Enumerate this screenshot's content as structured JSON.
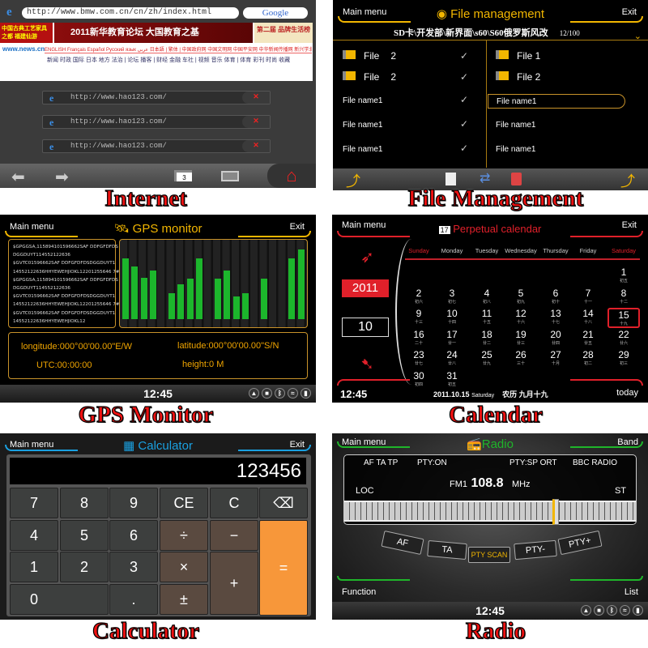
{
  "captions": {
    "internet": "Internet",
    "file": "File Management",
    "gps": "GPS Monitor",
    "calendar": "Calendar",
    "calculator": "Calculator",
    "radio": "Radio"
  },
  "internet": {
    "url": "http://www.bmw.com.cn/cn/zh/index.html",
    "search_logo": "Google",
    "page": {
      "ad_left": "中国古典工艺家具之都 福建仙游",
      "banner": "2011新华教育论坛 大国教育之基",
      "ad_right": "第二届 品牌生活榜",
      "site": "www.news.cn",
      "langs": "ENGLISH  Français  Español  Русский язык  عربي  日本語 | 繁体 | 中国政府网  中国文明网  中国平安网  中华新闻传播网  新兴学北网",
      "nav": "新闻 时政 国际 日本 地方 法治 | 论坛 播客 | 财经 金融 车社 | 视频 音乐 体育 | 体育 彩刊 时尚 收藏"
    },
    "history": [
      "http://www.hao123.com/",
      "http://www.hao123.com/",
      "http://www.hao123.com/"
    ],
    "tab_count": "3"
  },
  "file": {
    "main_menu": "Main menu",
    "title": "File management",
    "exit": "Exit",
    "path": "SD卡\\开发部\\新界面\\s60\\S60俄罗斯风改",
    "page": "12/100",
    "left": [
      {
        "label": "File",
        "num": "2",
        "folder": true
      },
      {
        "label": "File",
        "num": "2",
        "folder": true
      },
      {
        "label": "File name1",
        "folder": false
      },
      {
        "label": "File name1",
        "folder": false
      },
      {
        "label": "File name1",
        "folder": false
      }
    ],
    "right": [
      {
        "label": "File 1",
        "folder": true
      },
      {
        "label": "File 2",
        "folder": true
      },
      {
        "label": "File name1",
        "folder": false,
        "selected": true
      },
      {
        "label": "File name1",
        "folder": false
      },
      {
        "label": "File name1",
        "folder": false
      }
    ]
  },
  "gps": {
    "main_menu": "Main menu",
    "title": "GPS monitor",
    "exit": "Exit",
    "nmea": "$GPGGSA,115894101596662SAF DDFGFDFDS\nDGGDUYT114552122636\n$GVTC01596662SAF DDFGFDFDSDGGDUYT1\n14552122636HHYEWEHJIOKL12201255646 7#$\n$GPGGSA,115894101596662SAF DDFGFDFDS\nDGGDUYT114552122636\n$GVTC01596662SAF DDFGFDFDSDGGDUYT1\n14552122636HHYEWEHJIOKL12201255646 7#$\n$GVTC01596662SAF DDFGFDFDSDGGDUYT1\n14552122636HHYEWEHJIOKL12",
    "signal_levels": [
      79,
      68,
      54,
      63,
      0,
      34,
      45,
      53,
      79,
      0,
      53,
      63,
      29,
      34,
      0,
      53,
      0,
      0,
      79,
      91
    ],
    "longitude": "longitude:000°00'00.00\"E/W",
    "latitude": "latitude:000°00'00.00\"S/N",
    "utc": "UTC:00:00:00",
    "height": "height:0 M",
    "clock": "12:45"
  },
  "calendar": {
    "main_menu": "Main menu",
    "title": "Perpetual calendar",
    "exit": "Exit",
    "year": "2011",
    "month": "10",
    "weekdays": [
      "Sunday",
      "Monday",
      "Tuesday",
      "Wednesday",
      "Thursday",
      "Friday",
      "Saturday"
    ],
    "first_weekday": 6,
    "selected": 15,
    "lunar": [
      "初五",
      "初六",
      "初七",
      "初八",
      "初九",
      "初十",
      "十一",
      "十二",
      "十三",
      "十四",
      "十五",
      "十六",
      "十七",
      "十八",
      "十九",
      "二十",
      "廿一",
      "廿二",
      "廿三",
      "廿四",
      "廿五",
      "廿六",
      "廿七",
      "廿八",
      "廿九",
      "三十",
      "十月",
      "初二",
      "初三",
      "初四",
      "初五"
    ],
    "clock": "12:45",
    "date": "2011.10.15",
    "weekday": "Saturday",
    "lunar_date": "农历  九月十九",
    "today": "today",
    "accent": "#e0202a"
  },
  "calculator": {
    "main_menu": "Main menu",
    "title": "Calculator",
    "exit": "Exit",
    "display": "123456",
    "keys": [
      "7",
      "8",
      "9",
      "CE",
      "C",
      "⌫",
      "4",
      "5",
      "6",
      "÷",
      "−",
      "=",
      "1",
      "2",
      "3",
      "×",
      "+",
      "0",
      ".",
      "±"
    ]
  },
  "radio": {
    "main_menu": "Main menu",
    "title": "Radio",
    "band": "Band",
    "af_ta_tp": "AF TA TP",
    "pty_on": "PTY:ON",
    "pty_type": "PTY:SP ORT",
    "station": "BBC RADIO",
    "loc": "LOC",
    "st": "ST",
    "band_name": "FM1",
    "freq": "108.8",
    "unit": "MHz",
    "tuner_position": 0.73,
    "buttons": [
      "AF",
      "TA",
      "PTY SCAN",
      "PTY-",
      "PTY+"
    ],
    "function": "Function",
    "list": "List",
    "clock": "12:45",
    "accent": "#1fb52a"
  }
}
